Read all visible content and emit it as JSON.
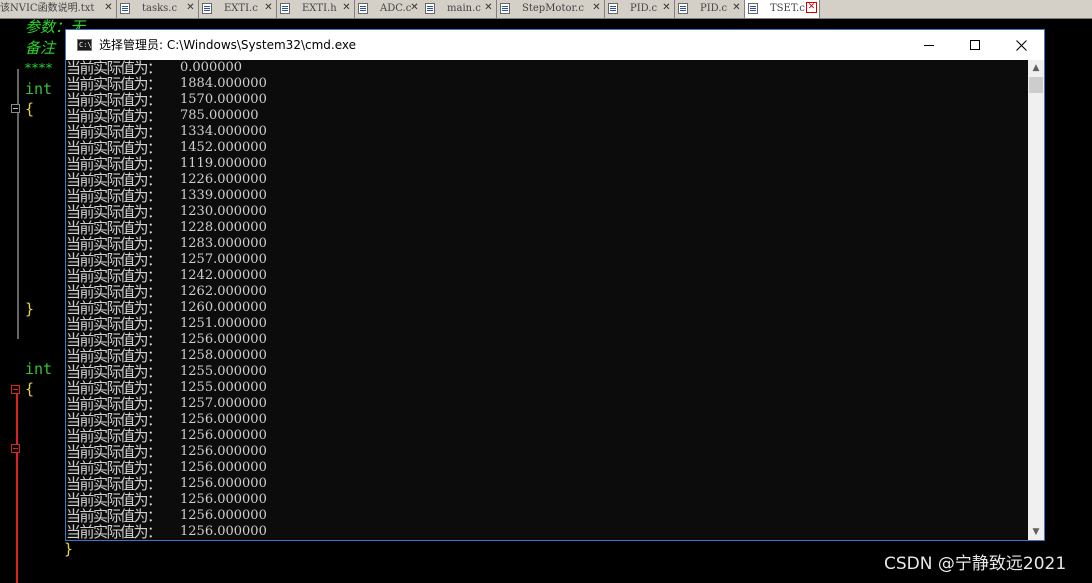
{
  "editor": {
    "tabs": [
      {
        "label": "该NVIC函数说明.txt"
      },
      {
        "label": "tasks.c"
      },
      {
        "label": "EXTI.c"
      },
      {
        "label": "EXTI.h"
      },
      {
        "label": "ADC.c"
      },
      {
        "label": "main.c"
      },
      {
        "label": "StepMotor.c"
      },
      {
        "label": "PID.c"
      },
      {
        "label": "PID.c"
      },
      {
        "label": "TSET.c"
      }
    ],
    "code_fragments": {
      "comment_line1": "参数：无",
      "comment_line2": "备注",
      "stars": "****",
      "int1": "int",
      "brace_open1": "{",
      "brace_close1": "}",
      "int2": "int",
      "brace_open2": "{",
      "brace_close2": "}"
    }
  },
  "cmd_window": {
    "title": "选择管理员: C:\\Windows\\System32\\cmd.exe",
    "icon_text": "C:\\",
    "line_label": "当前实际值为：",
    "lines": [
      "0.000000",
      "1884.000000",
      "1570.000000",
      "785.000000",
      "1334.000000",
      "1452.000000",
      "1119.000000",
      "1226.000000",
      "1339.000000",
      "1230.000000",
      "1228.000000",
      "1283.000000",
      "1257.000000",
      "1242.000000",
      "1262.000000",
      "1260.000000",
      "1251.000000",
      "1256.000000",
      "1258.000000",
      "1255.000000",
      "1255.000000",
      "1257.000000",
      "1256.000000",
      "1256.000000",
      "1256.000000",
      "1256.000000",
      "1256.000000",
      "1256.000000",
      "1256.000000",
      "1256.000000"
    ]
  },
  "watermark": "CSDN @宁静致远2021"
}
